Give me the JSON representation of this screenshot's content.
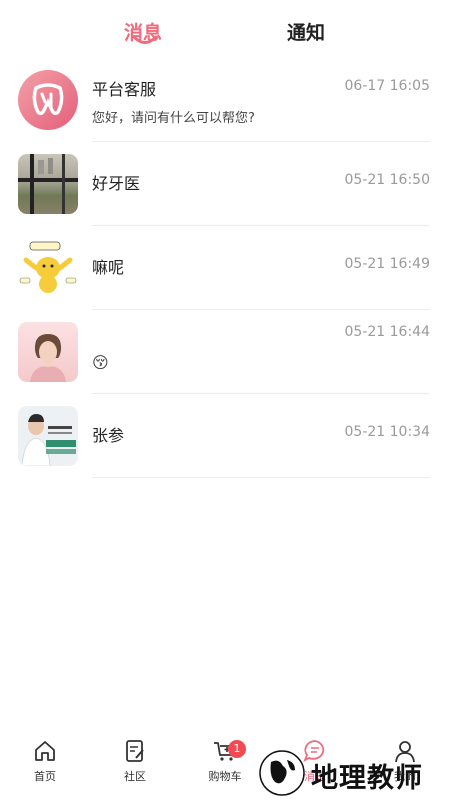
{
  "tabs": {
    "messages": "消息",
    "notifications": "通知"
  },
  "conversations": [
    {
      "name": "平台客服",
      "time": "06-17 16:05",
      "preview": "您好，请问有什么可以帮您?"
    },
    {
      "name": "好牙医",
      "time": "05-21 16:50",
      "preview": ""
    },
    {
      "name": "嘛呢",
      "time": "05-21 16:49",
      "preview": ""
    },
    {
      "name": "",
      "time": "05-21 16:44",
      "preview": "😚"
    },
    {
      "name": "张参",
      "time": "05-21 10:34",
      "preview": ""
    }
  ],
  "tabbar": {
    "home": "首页",
    "community": "社区",
    "cart": "购物车",
    "cart_badge": "1",
    "messages": "消息",
    "mine": "我的"
  },
  "watermark": {
    "text": "地理教师"
  },
  "colors": {
    "accent": "#ef6b7d",
    "badge": "#f24a52"
  }
}
